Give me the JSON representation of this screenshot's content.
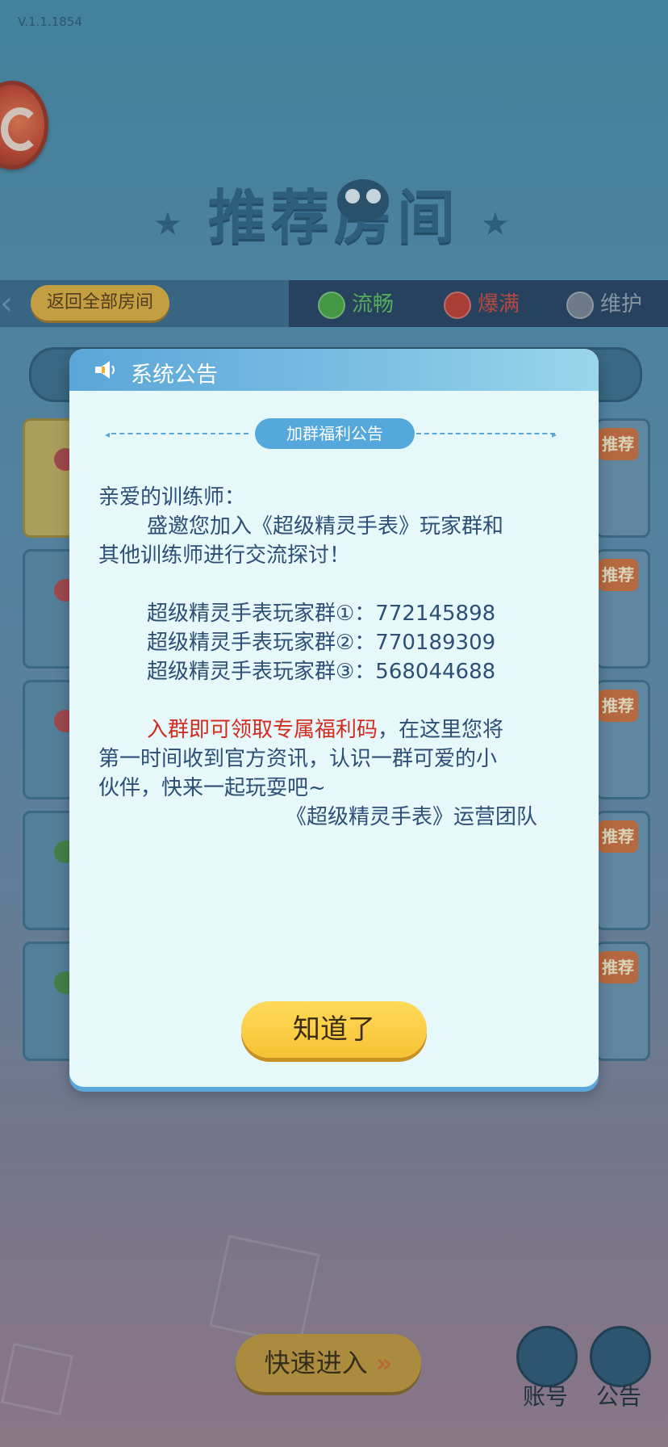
{
  "version": "V.1.1.1854",
  "page_title": "推荐房间",
  "filter": {
    "back_label": "返回全部房间",
    "status": [
      {
        "label": "流畅",
        "color": "#5fc35a"
      },
      {
        "label": "爆满",
        "color": "#d44a3c"
      },
      {
        "label": "维护",
        "color": "#9aa7b3"
      }
    ]
  },
  "room_tag": "推荐",
  "modal": {
    "title": "系统公告",
    "section_pill": "加群福利公告",
    "greeting": "亲爱的训练师：",
    "invite_line1": "盛邀您加入《超级精灵手表》玩家群和",
    "invite_line2": "其他训练师进行交流探讨！",
    "groups": [
      "超级精灵手表玩家群①：772145898",
      "超级精灵手表玩家群②：770189309",
      "超级精灵手表玩家群③：568044688"
    ],
    "highlight": "入群即可领取专属福利码",
    "after_highlight": "，在这里您将",
    "line2": "第一时间收到官方资讯，认识一群可爱的小",
    "line3": "伙伴，快来一起玩耍吧~",
    "signature": "《超级精灵手表》运营团队",
    "confirm_label": "知道了"
  },
  "bottom": {
    "quick_enter_label": "快速进入",
    "quick_enter_arrows": "»",
    "account_label": "账号",
    "notice_label": "公告"
  },
  "colors": {
    "accent_blue": "#55a8db",
    "highlight_red": "#d42a20",
    "button_yellow": "#f6c334"
  }
}
